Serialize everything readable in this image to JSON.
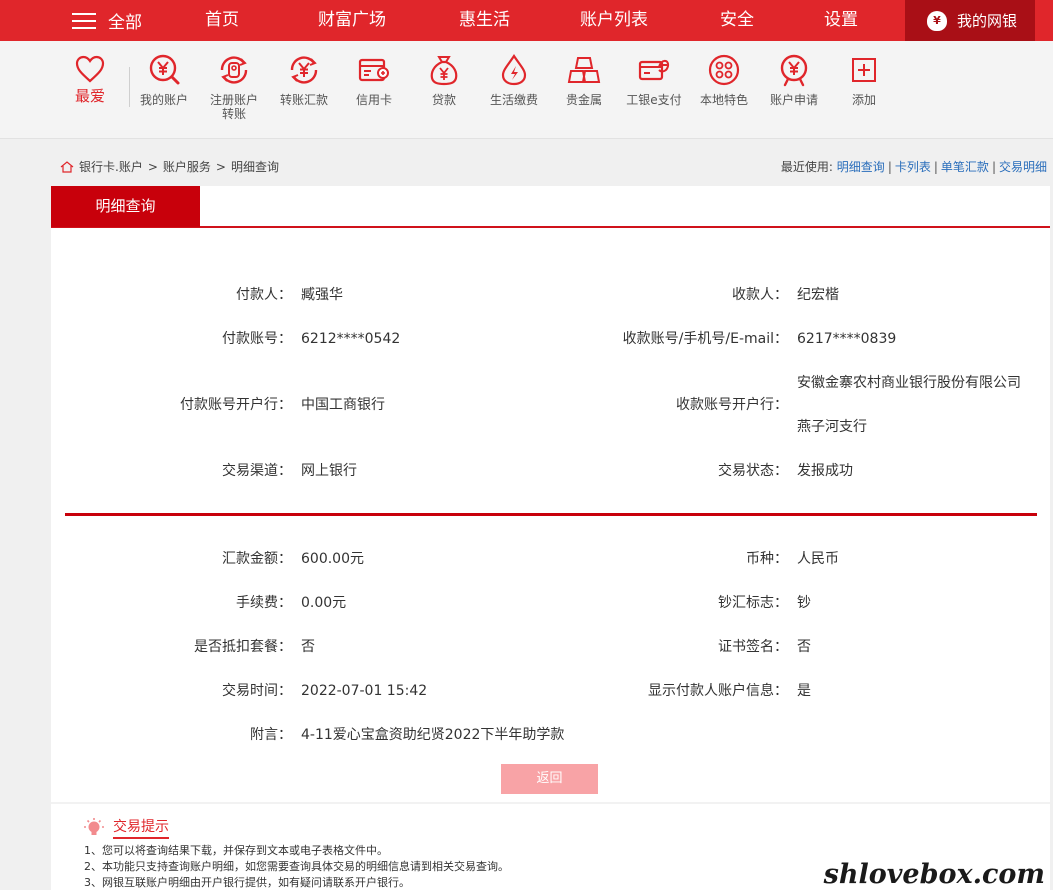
{
  "topnav": {
    "all_label": "全部",
    "items": [
      "首页",
      "财富广场",
      "惠生活",
      "账户列表",
      "安全",
      "设置"
    ],
    "mybank_label": "我的网银"
  },
  "favorites": {
    "label": "最爱",
    "items": [
      {
        "label": "我的账户",
        "icon": "yuan-search-icon"
      },
      {
        "label": "注册账户转账",
        "icon": "register-transfer-icon"
      },
      {
        "label": "转账汇款",
        "icon": "transfer-icon"
      },
      {
        "label": "信用卡",
        "icon": "credit-card-icon"
      },
      {
        "label": "贷款",
        "icon": "loan-bag-icon"
      },
      {
        "label": "生活缴费",
        "icon": "utility-payment-icon"
      },
      {
        "label": "贵金属",
        "icon": "gold-bars-icon"
      },
      {
        "label": "工银e支付",
        "icon": "e-pay-icon"
      },
      {
        "label": "本地特色",
        "icon": "local-feature-icon"
      },
      {
        "label": "账户申请",
        "icon": "account-apply-icon"
      },
      {
        "label": "添加",
        "icon": "add-icon"
      }
    ]
  },
  "breadcrumb": {
    "items": [
      "银行卡.账户",
      "账户服务",
      "明细查询"
    ],
    "separator": ">"
  },
  "recent": {
    "label": "最近使用:",
    "links": [
      "明细查询",
      "卡列表",
      "单笔汇款",
      "交易明细"
    ]
  },
  "tab": {
    "label": "明细查询"
  },
  "details": {
    "payer_label": "付款人：",
    "payer": "臧强华",
    "payee_label": "收款人：",
    "payee": "纪宏楷",
    "payer_account_label": "付款账号：",
    "payer_account": "6212****0542",
    "payee_account_label": "收款账号/手机号/E-mail：",
    "payee_account": "6217****0839",
    "payer_bank_label": "付款账号开户行：",
    "payer_bank": "中国工商银行",
    "payee_bank_label": "收款账号开户行：",
    "payee_bank_line1": "安徽金寨农村商业银行股份有限公司",
    "payee_bank_line2": "燕子河支行",
    "channel_label": "交易渠道：",
    "channel": "网上银行",
    "status_label": "交易状态：",
    "status": "发报成功",
    "amount_label": "汇款金额：",
    "amount": "600.00元",
    "currency_label": "币种：",
    "currency": "人民币",
    "fee_label": "手续费：",
    "fee": "0.00元",
    "cash_flag_label": "钞汇标志：",
    "cash_flag": "钞",
    "package_label": "是否抵扣套餐：",
    "package": "否",
    "cert_label": "证书签名：",
    "cert": "否",
    "time_label": "交易时间：",
    "time": "2022-07-01 15:42",
    "show_payer_label": "显示付款人账户信息：",
    "show_payer": "是",
    "memo_label": "附言：",
    "memo": "4-11爱心宝盒资助纪贤2022下半年助学款"
  },
  "back_button": "返回",
  "tips": {
    "title": "交易提示",
    "items": [
      "1、您可以将查询结果下载，并保存到文本或电子表格文件中。",
      "2、本功能只支持查询账户明细，如您需要查询具体交易的明细信息请到相关交易查询。",
      "3、网银互联账户明细由开户银行提供，如有疑问请联系开户银行。"
    ]
  },
  "watermark": "shlovebox.com",
  "colors": {
    "brand_red": "#e0262b",
    "dark_red": "#a90f16",
    "link_blue": "#2a6ebb"
  }
}
